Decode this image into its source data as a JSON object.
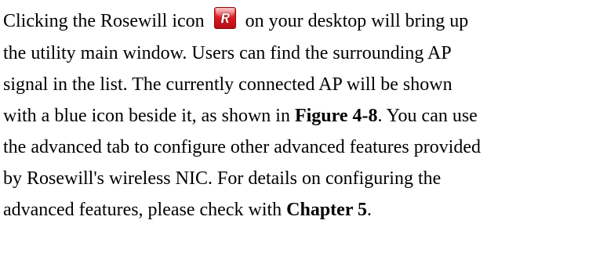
{
  "document": {
    "lines": [
      {
        "parts": [
          {
            "text": "Clicking the Rosewill icon"
          },
          {
            "icon": "rosewill-r-icon"
          },
          {
            "text": "on your desktop will bring up"
          }
        ]
      },
      {
        "parts": [
          {
            "text": "the utility main window. Users can find the surrounding AP"
          }
        ]
      },
      {
        "parts": [
          {
            "text": "signal in the list. The currently connected AP will be shown"
          }
        ]
      },
      {
        "parts": [
          {
            "text": "with a blue icon beside it, as shown in "
          },
          {
            "text": "Figure 4-8",
            "bold": true
          },
          {
            "text": ". You can use"
          }
        ]
      },
      {
        "parts": [
          {
            "text": "the advanced tab to configure other advanced features provided"
          }
        ]
      },
      {
        "parts": [
          {
            "text": "by Rosewill's wireless NIC. For details on configuring the"
          }
        ]
      },
      {
        "parts": [
          {
            "text": "advanced features, please check with "
          },
          {
            "text": "Chapter 5",
            "bold": true
          },
          {
            "text": "."
          }
        ]
      }
    ],
    "icon_colors": {
      "base": "#d6161c",
      "letter": "#ffffff"
    }
  }
}
